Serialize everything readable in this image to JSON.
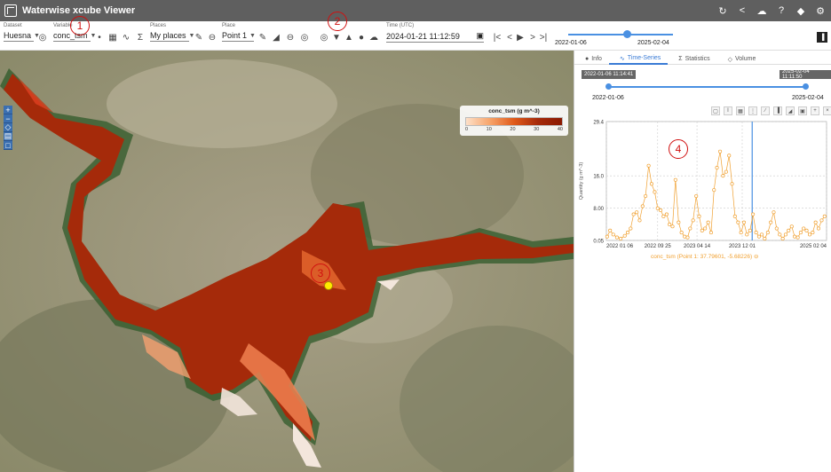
{
  "app": {
    "title": "Waterwise xcube Viewer"
  },
  "toolbar": {
    "dataset": {
      "label": "Dataset",
      "value": "Huesna"
    },
    "variable": {
      "label": "Variable",
      "value": "conc_tsm"
    },
    "places": {
      "label": "Places",
      "value": "My places"
    },
    "place": {
      "label": "Place",
      "value": "Point 1"
    },
    "time": {
      "label": "Time (UTC)",
      "value": "2024-01-21 11:12:59"
    },
    "slider": {
      "start": "2022-01-06",
      "end": "2025-02-04",
      "position": 0.53
    }
  },
  "annotations": [
    "1",
    "2",
    "3",
    "4"
  ],
  "legend": {
    "title": "conc_tsm (g m^-3)",
    "ticks": [
      "0",
      "10",
      "20",
      "30",
      "40"
    ]
  },
  "panel": {
    "tabs": [
      {
        "label": "Info",
        "icon": "info-icon"
      },
      {
        "label": "Time-Series",
        "icon": "timeseries-icon",
        "active": true
      },
      {
        "label": "Statistics",
        "icon": "sigma-icon"
      },
      {
        "label": "Volume",
        "icon": "cube-icon"
      }
    ],
    "range_start": "2022-01-06 11:14:41",
    "range_end": "2025-02-04 11:11:50",
    "slider_start": "2022-01-06",
    "slider_end": "2025-02-04"
  },
  "chart_data": {
    "type": "line",
    "ylabel": "Quantity (g m^-3)",
    "yticks": [
      "0.05",
      "8.00",
      "16.0",
      "29.4"
    ],
    "ylim": [
      0.05,
      29.4
    ],
    "xticks": [
      "2022 01 06",
      "2022 09 25",
      "2023 04 14",
      "2023 12 01",
      "2025 02 04"
    ],
    "current_time": "2024-01-21",
    "series": [
      {
        "name": "conc_tsm (Point 1: 37.79601, -5.68226)",
        "x": [
          "2022-01-10",
          "2022-01-25",
          "2022-02-10",
          "2022-03-01",
          "2022-03-20",
          "2022-04-10",
          "2022-04-25",
          "2022-05-10",
          "2022-05-25",
          "2022-06-10",
          "2022-06-25",
          "2022-07-10",
          "2022-07-25",
          "2022-08-10",
          "2022-08-25",
          "2022-09-10",
          "2022-09-25",
          "2022-10-10",
          "2022-10-25",
          "2022-11-10",
          "2022-11-25",
          "2022-12-10",
          "2022-12-25",
          "2023-01-10",
          "2023-01-25",
          "2023-02-10",
          "2023-02-25",
          "2023-03-10",
          "2023-03-25",
          "2023-04-10",
          "2023-04-25",
          "2023-05-10",
          "2023-05-25",
          "2023-06-10",
          "2023-06-25",
          "2023-07-10",
          "2023-07-25",
          "2023-08-10",
          "2023-08-25",
          "2023-09-10",
          "2023-09-25",
          "2023-10-10",
          "2023-10-25",
          "2023-11-10",
          "2023-11-25",
          "2023-12-10",
          "2023-12-25",
          "2024-01-10",
          "2024-01-25",
          "2024-02-10",
          "2024-02-25",
          "2024-03-10",
          "2024-03-25",
          "2024-04-10",
          "2024-04-25",
          "2024-05-10",
          "2024-05-25",
          "2024-06-10",
          "2024-06-25",
          "2024-07-10",
          "2024-07-25",
          "2024-08-10",
          "2024-08-25",
          "2024-09-10",
          "2024-09-25",
          "2024-10-10",
          "2024-10-25",
          "2024-11-10",
          "2024-11-25",
          "2024-12-10",
          "2024-12-25",
          "2025-01-10",
          "2025-01-25"
        ],
        "y": [
          1.0,
          2.5,
          1.5,
          0.8,
          0.5,
          1.2,
          2.0,
          3.0,
          6.5,
          7.0,
          5.0,
          8.5,
          11.0,
          18.5,
          14.0,
          12.0,
          8.0,
          7.5,
          6.0,
          6.5,
          4.0,
          3.5,
          15.0,
          4.5,
          2.0,
          1.0,
          0.8,
          3.0,
          5.0,
          11.0,
          6.0,
          2.5,
          3.0,
          4.5,
          2.0,
          12.5,
          18.0,
          22.0,
          16.0,
          17.0,
          21.0,
          14.0,
          6.0,
          4.5,
          2.0,
          4.5,
          1.5,
          2.5,
          6.5,
          2.0,
          1.0,
          1.5,
          0.5,
          2.0,
          4.5,
          7.0,
          3.0,
          1.5,
          0.5,
          1.5,
          2.5,
          3.5,
          1.0,
          0.8,
          2.0,
          3.0,
          2.5,
          1.5,
          2.0,
          4.5,
          3.0,
          5.0,
          6.0
        ]
      }
    ]
  },
  "colors": {
    "accent": "#3a7bd5",
    "series": "#f0a030",
    "reservoir": "#a52a0a",
    "annotation": "#d01010"
  }
}
